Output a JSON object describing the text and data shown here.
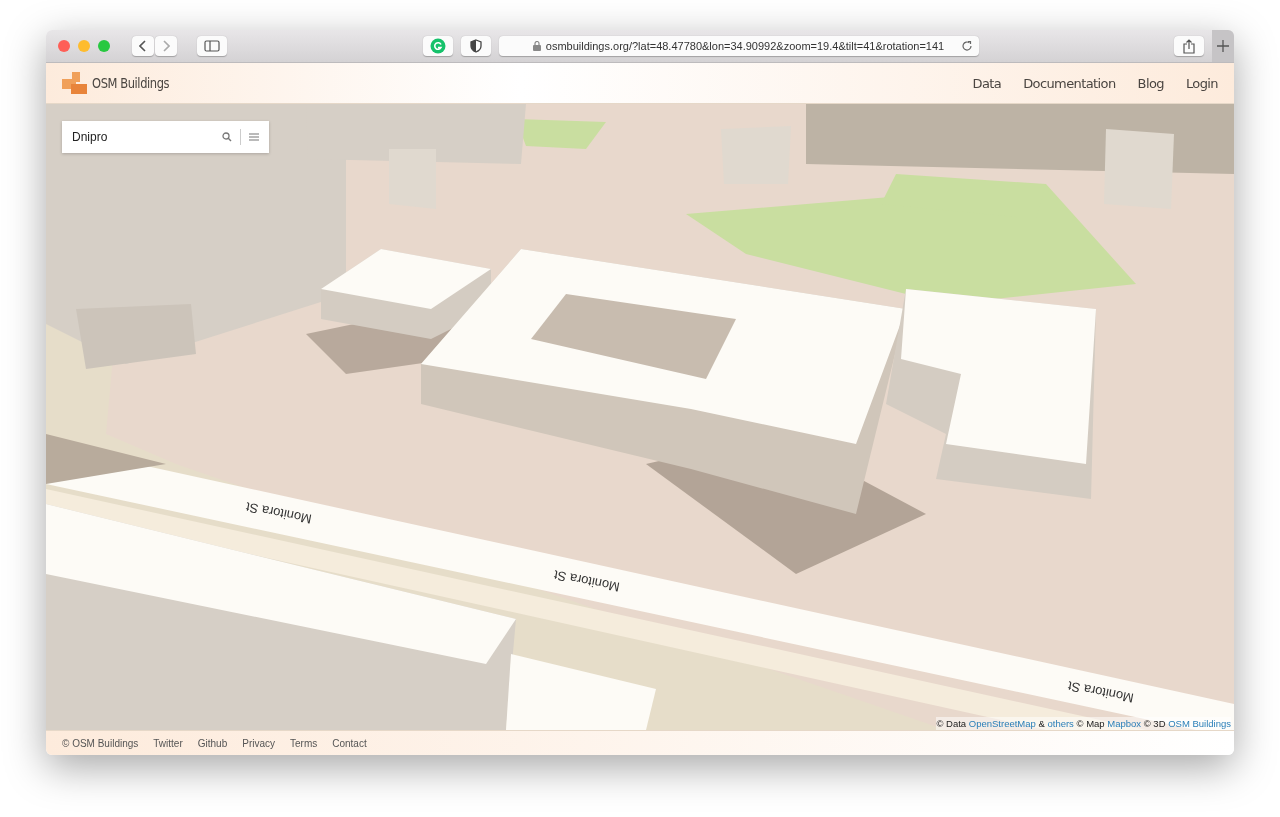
{
  "browser": {
    "url": "osmbuildings.org/?lat=48.47780&lon=34.90992&zoom=19.4&tilt=41&rotation=141"
  },
  "header": {
    "brand": "OSM Buildings",
    "nav": [
      "Data",
      "Documentation",
      "Blog",
      "Login"
    ]
  },
  "search": {
    "value": "Dnipro"
  },
  "map": {
    "street_labels": [
      {
        "text": "Monitora St"
      },
      {
        "text": "Monitora St"
      },
      {
        "text": "Monitora St"
      }
    ]
  },
  "attribution": [
    {
      "kind": "text",
      "text": "© Data"
    },
    {
      "kind": "link",
      "text": "OpenStreetMap"
    },
    {
      "kind": "text",
      "text": "&"
    },
    {
      "kind": "link",
      "text": "others"
    },
    {
      "kind": "text",
      "text": "© Map"
    },
    {
      "kind": "link",
      "text": "Mapbox"
    },
    {
      "kind": "text",
      "text": "© 3D"
    },
    {
      "kind": "link",
      "text": "OSM Buildings"
    }
  ],
  "footer": [
    "© OSM Buildings",
    "Twitter",
    "Github",
    "Privacy",
    "Terms",
    "Contact"
  ]
}
